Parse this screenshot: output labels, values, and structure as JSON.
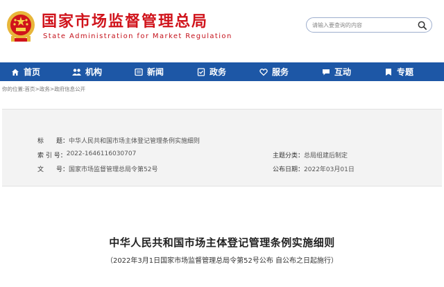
{
  "site": {
    "title_cn": "国家市场监督管理总局",
    "title_en": "State Administration for Market Regulation"
  },
  "search": {
    "placeholder": "请输入要查询的内容"
  },
  "nav": {
    "items": [
      {
        "label": "首页",
        "icon": "home-icon"
      },
      {
        "label": "机构",
        "icon": "org-icon"
      },
      {
        "label": "新闻",
        "icon": "news-icon"
      },
      {
        "label": "政务",
        "icon": "affairs-icon"
      },
      {
        "label": "服务",
        "icon": "service-icon"
      },
      {
        "label": "互动",
        "icon": "interact-icon"
      },
      {
        "label": "专题",
        "icon": "topic-icon"
      }
    ]
  },
  "breadcrumb": {
    "prefix": "你的位置:",
    "items": [
      "首页",
      "政务",
      "政府信息公开"
    ],
    "separator": ">"
  },
  "info": {
    "title_label": "标　　题：",
    "title_value": "中华人民共和国市场主体登记管理条例实施细则",
    "index_label": "索 引 号：",
    "index_value": "2022-1646116030707",
    "doc_label": "文　　号：",
    "doc_value": "国家市场监督管理总局令第52号",
    "category_label": "主题分类：",
    "category_value": "总局组建后制定",
    "date_label": "公布日期：",
    "date_value": "2022年03月01日"
  },
  "article": {
    "title": "中华人民共和国市场主体登记管理条例实施细则",
    "subtitle": "（2022年3月1日国家市场监督管理总局令第52号公布 自公布之日起施行）"
  },
  "colors": {
    "brand_red": "#d0131b",
    "nav_blue": "#1d57a6"
  }
}
